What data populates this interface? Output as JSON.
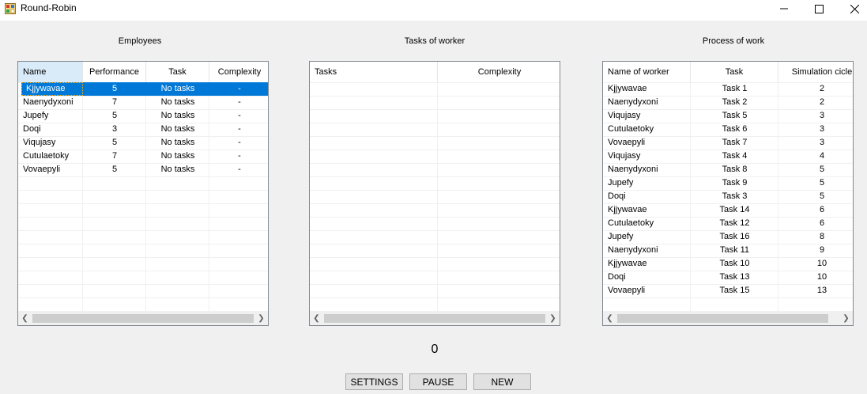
{
  "window": {
    "title": "Round-Robin",
    "minimize_glyph": "minimize-icon",
    "maximize_glyph": "maximize-icon",
    "close_glyph": "close-icon"
  },
  "labels": {
    "employees": "Employees",
    "tasks_of_worker": "Tasks of worker",
    "process_of_work": "Process of work"
  },
  "employees": {
    "columns": [
      "Name",
      "Performance",
      "Task",
      "Complexity"
    ],
    "rows": [
      [
        "Kjjywavae",
        "5",
        "No tasks",
        "-"
      ],
      [
        "Naenydyxoni",
        "7",
        "No tasks",
        "-"
      ],
      [
        "Jupefy",
        "5",
        "No tasks",
        "-"
      ],
      [
        "Doqi",
        "3",
        "No tasks",
        "-"
      ],
      [
        "Viqujasy",
        "5",
        "No tasks",
        "-"
      ],
      [
        "Cutulaetoky",
        "7",
        "No tasks",
        "-"
      ],
      [
        "Vovaepyli",
        "5",
        "No tasks",
        "-"
      ]
    ],
    "selected_index": 0
  },
  "tasks": {
    "columns": [
      "Tasks",
      "Complexity"
    ],
    "rows": []
  },
  "process": {
    "columns": [
      "Name of worker",
      "Task",
      "Simulation cicle"
    ],
    "rows": [
      [
        "Kjjywavae",
        "Task 1",
        "2"
      ],
      [
        "Naenydyxoni",
        "Task 2",
        "2"
      ],
      [
        "Viqujasy",
        "Task 5",
        "3"
      ],
      [
        "Cutulaetoky",
        "Task 6",
        "3"
      ],
      [
        "Vovaepyli",
        "Task 7",
        "3"
      ],
      [
        "Viqujasy",
        "Task 4",
        "4"
      ],
      [
        "Naenydyxoni",
        "Task 8",
        "5"
      ],
      [
        "Jupefy",
        "Task 9",
        "5"
      ],
      [
        "Doqi",
        "Task 3",
        "5"
      ],
      [
        "Kjjywavae",
        "Task 14",
        "6"
      ],
      [
        "Cutulaetoky",
        "Task 12",
        "6"
      ],
      [
        "Jupefy",
        "Task 16",
        "8"
      ],
      [
        "Naenydyxoni",
        "Task 11",
        "9"
      ],
      [
        "Kjjywavae",
        "Task 10",
        "10"
      ],
      [
        "Doqi",
        "Task 13",
        "10"
      ],
      [
        "Vovaepyli",
        "Task 15",
        "13"
      ]
    ]
  },
  "counter": "0",
  "buttons": {
    "settings": "SETTINGS",
    "pause": "PAUSE",
    "new": "NEW"
  },
  "colors": {
    "selection": "#0078d7",
    "sorted_header": "#d9ebf9",
    "window_bg": "#f0f0f0"
  }
}
